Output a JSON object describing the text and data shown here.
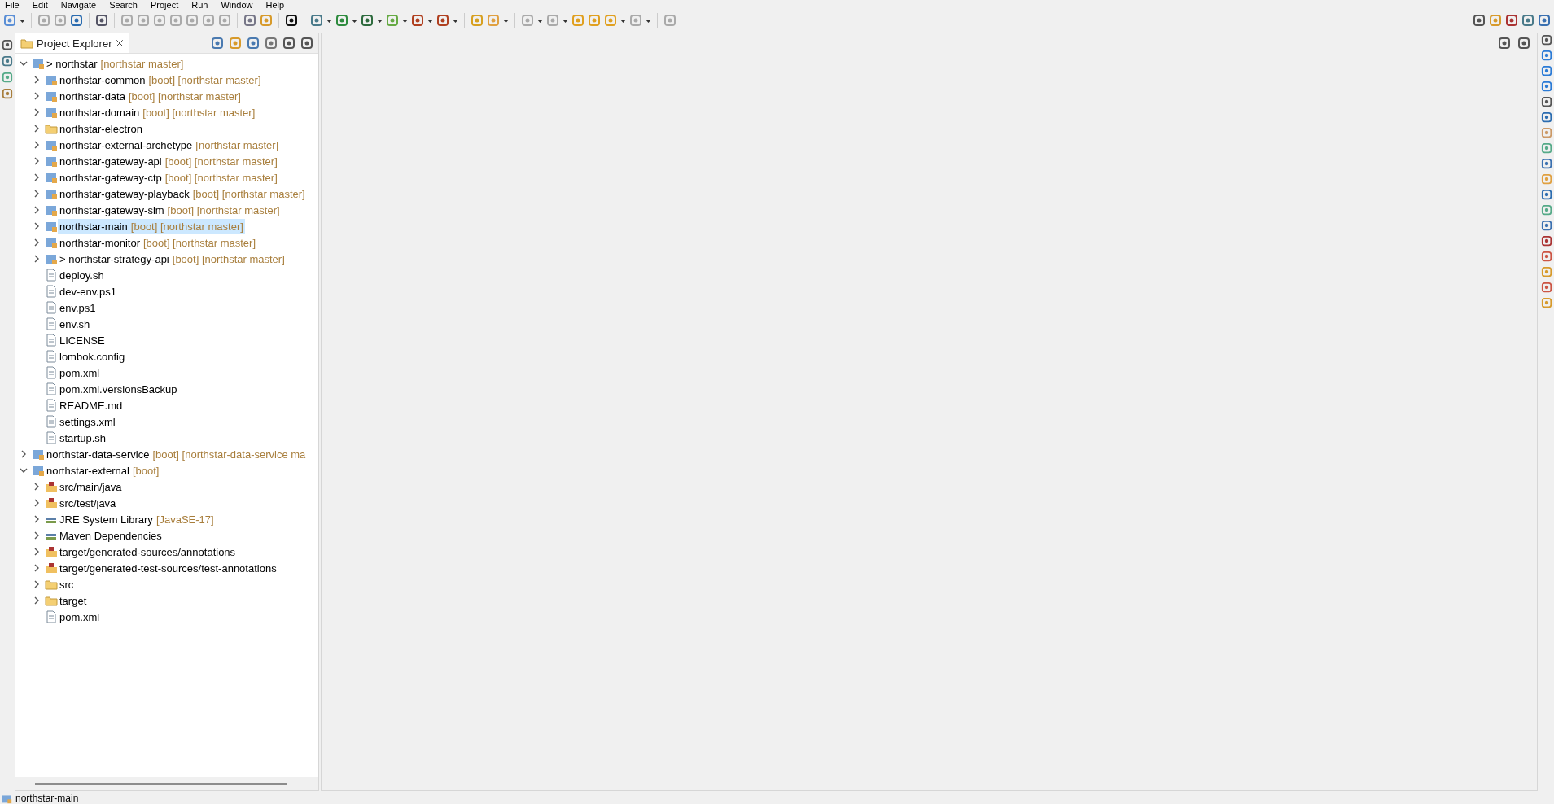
{
  "menu": [
    "File",
    "Edit",
    "Navigate",
    "Search",
    "Project",
    "Run",
    "Window",
    "Help"
  ],
  "explorer": {
    "title": "Project Explorer",
    "tree": [
      {
        "label": "> northstar",
        "decoration": "[northstar master]",
        "kind": "project",
        "expanded": true,
        "selected": false,
        "children": [
          {
            "label": "northstar-common",
            "decoration": "[boot] [northstar master]",
            "kind": "project",
            "expanded": false,
            "selected": false
          },
          {
            "label": "northstar-data",
            "decoration": "[boot] [northstar master]",
            "kind": "project",
            "expanded": false,
            "selected": false
          },
          {
            "label": "northstar-domain",
            "decoration": "[boot] [northstar master]",
            "kind": "project",
            "expanded": false,
            "selected": false
          },
          {
            "label": "northstar-electron",
            "kind": "folder",
            "expanded": false,
            "selected": false
          },
          {
            "label": "northstar-external-archetype",
            "decoration": "[northstar master]",
            "kind": "project",
            "expanded": false,
            "selected": false
          },
          {
            "label": "northstar-gateway-api",
            "decoration": "[boot] [northstar master]",
            "kind": "project",
            "expanded": false,
            "selected": false
          },
          {
            "label": "northstar-gateway-ctp",
            "decoration": "[boot] [northstar master]",
            "kind": "project",
            "expanded": false,
            "selected": false
          },
          {
            "label": "northstar-gateway-playback",
            "decoration": "[boot] [northstar master]",
            "kind": "project",
            "expanded": false,
            "selected": false
          },
          {
            "label": "northstar-gateway-sim",
            "decoration": "[boot] [northstar master]",
            "kind": "project",
            "expanded": false,
            "selected": false
          },
          {
            "label": "northstar-main",
            "decoration": "[boot] [northstar master]",
            "kind": "project",
            "expanded": false,
            "selected": true
          },
          {
            "label": "northstar-monitor",
            "decoration": "[boot] [northstar master]",
            "kind": "project",
            "expanded": false,
            "selected": false
          },
          {
            "label": "> northstar-strategy-api",
            "decoration": "[boot] [northstar master]",
            "kind": "project",
            "expanded": false,
            "selected": false
          },
          {
            "label": "deploy.sh",
            "kind": "file",
            "selected": false
          },
          {
            "label": "dev-env.ps1",
            "kind": "file",
            "selected": false
          },
          {
            "label": "env.ps1",
            "kind": "file",
            "selected": false
          },
          {
            "label": "env.sh",
            "kind": "file",
            "selected": false
          },
          {
            "label": "LICENSE",
            "kind": "file",
            "selected": false
          },
          {
            "label": "lombok.config",
            "kind": "file",
            "selected": false
          },
          {
            "label": "pom.xml",
            "kind": "file",
            "selected": false
          },
          {
            "label": "pom.xml.versionsBackup",
            "kind": "file",
            "selected": false
          },
          {
            "label": "README.md",
            "kind": "file",
            "selected": false
          },
          {
            "label": "settings.xml",
            "kind": "file",
            "selected": false
          },
          {
            "label": "startup.sh",
            "kind": "file",
            "selected": false
          }
        ]
      },
      {
        "label": "northstar-data-service",
        "decoration": "[boot] [northstar-data-service ma",
        "kind": "project",
        "expanded": false,
        "selected": false
      },
      {
        "label": "northstar-external",
        "decoration": "[boot]",
        "kind": "project",
        "expanded": true,
        "selected": false,
        "children": [
          {
            "label": "src/main/java",
            "kind": "package",
            "expanded": false,
            "selected": false
          },
          {
            "label": "src/test/java",
            "kind": "package",
            "expanded": false,
            "selected": false
          },
          {
            "label": "JRE System Library",
            "decoration": "[JavaSE-17]",
            "kind": "library",
            "expanded": false,
            "selected": false
          },
          {
            "label": "Maven Dependencies",
            "kind": "library",
            "expanded": false,
            "selected": false
          },
          {
            "label": "target/generated-sources/annotations",
            "kind": "package",
            "expanded": false,
            "selected": false
          },
          {
            "label": "target/generated-test-sources/test-annotations",
            "kind": "package",
            "expanded": false,
            "selected": false
          },
          {
            "label": "src",
            "kind": "folder",
            "expanded": false,
            "selected": false
          },
          {
            "label": "target",
            "kind": "folder",
            "expanded": false,
            "selected": false
          },
          {
            "label": "pom.xml",
            "kind": "file",
            "selected": false
          }
        ]
      }
    ]
  },
  "status_bar": {
    "text": "northstar-main"
  }
}
